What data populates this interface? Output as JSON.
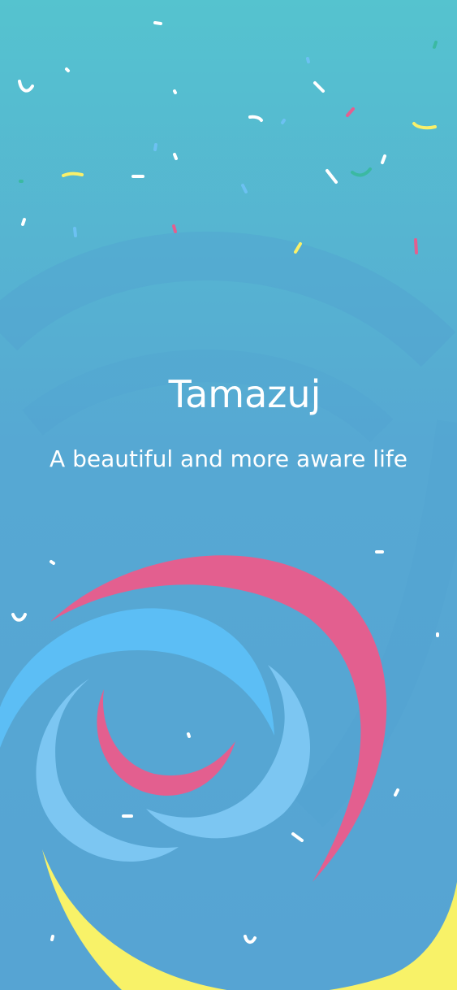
{
  "app": {
    "title": "Tamazuj",
    "tagline": "A beautiful and more aware life"
  },
  "colors": {
    "background_top": "#55c3cf",
    "background_bottom": "#56a4d3",
    "swirl_shadow": "#52a0d1",
    "pink": "#e35f8f",
    "blue": "#5cbef5",
    "light_blue": "#7cc6f2",
    "yellow": "#f8f268",
    "confetti_white": "#ffffff",
    "confetti_yellow": "#f9f06a",
    "confetti_pink": "#e35f8f",
    "confetti_green": "#3bb9a2",
    "confetti_blue": "#6cc1f2"
  },
  "decorations": {
    "background": "splash-swirl",
    "confetti": "confetti-sprinkles"
  }
}
